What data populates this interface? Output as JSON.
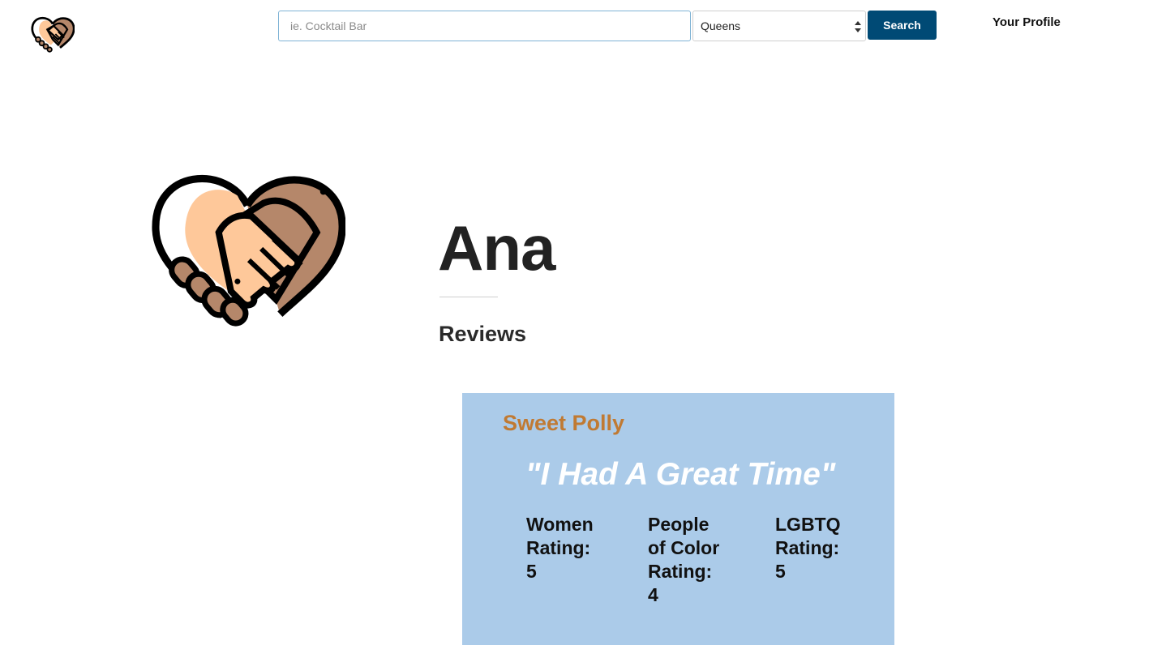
{
  "navbar": {
    "search_placeholder": "ie. Cocktail Bar",
    "borough_selected": "Queens",
    "search_label": "Search",
    "profile_label": "Your Profile"
  },
  "icons": {
    "logo": "heart-handshake-icon",
    "select_arrows": "up-down-arrows-icon"
  },
  "profile": {
    "name": "Ana",
    "reviews_heading": "Reviews"
  },
  "reviews": [
    {
      "venue": "Sweet Polly",
      "quote": "\"I Had A Great Time\"",
      "ratings": [
        {
          "label_lines": [
            "Women",
            "Rating:"
          ],
          "value": "5"
        },
        {
          "label_lines": [
            "People",
            "of Color",
            "Rating:"
          ],
          "value": "4"
        },
        {
          "label_lines": [
            "LGBTQ",
            "Rating:"
          ],
          "value": "5"
        }
      ]
    }
  ],
  "colors": {
    "search_button": "#004a75",
    "card_background": "#abcbe9",
    "venue_name": "#c07a33",
    "quote_text": "#ffffff",
    "logo_light_hand": "#fec89a",
    "logo_dark_hand": "#b5876a"
  }
}
